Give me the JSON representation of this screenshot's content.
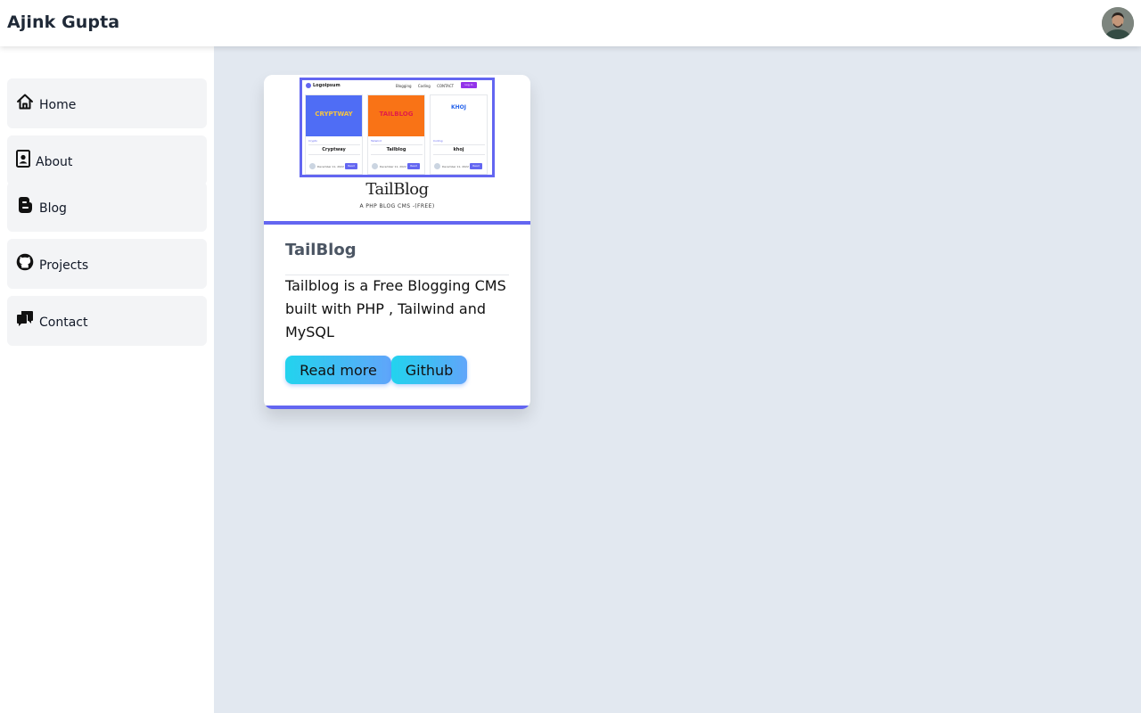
{
  "header": {
    "title": "Ajink Gupta",
    "avatar_icon": "user-avatar"
  },
  "sidebar": {
    "items": [
      {
        "label": "Home",
        "icon": "home-icon"
      },
      {
        "label": "About",
        "icon": "contact-file-icon"
      },
      {
        "label": "Blog",
        "icon": "blogger-icon"
      },
      {
        "label": "Projects",
        "icon": "github-icon"
      },
      {
        "label": "Contact",
        "icon": "chat-bubbles-icon"
      }
    ]
  },
  "project_card": {
    "title": "TailBlog",
    "description": "Tailblog is a Free Blogging CMS built with PHP , Tailwind and MySQL",
    "buttons": {
      "read_more": "Read more",
      "github": "Github"
    },
    "thumbnail": {
      "brand": "Logoipsum",
      "menu": [
        "Blogging",
        "Coding",
        "CONTACT"
      ],
      "login": "Log In",
      "heading": "TailBlog",
      "subheading": "A PHP BLOG CMS -(FREE)",
      "cards": [
        {
          "image_text": "CRYPTWAY",
          "meta": "Crypto",
          "title": "Cryptway",
          "date": "December 11, 2022",
          "button": "Read"
        },
        {
          "image_text": "TAILBLOG",
          "meta": "Tailwind",
          "title": "Tailblog",
          "date": "December 11, 2022",
          "button": "Read"
        },
        {
          "image_text": "KHOJ",
          "meta": "Coding",
          "title": "khoj",
          "date": "December 11, 2022",
          "button": "Read"
        }
      ]
    }
  },
  "colors": {
    "accent": "#6366f1",
    "button_gradient_start": "#22d3ee",
    "button_gradient_end": "#60a5fa",
    "page_background": "#e2e8f0"
  }
}
